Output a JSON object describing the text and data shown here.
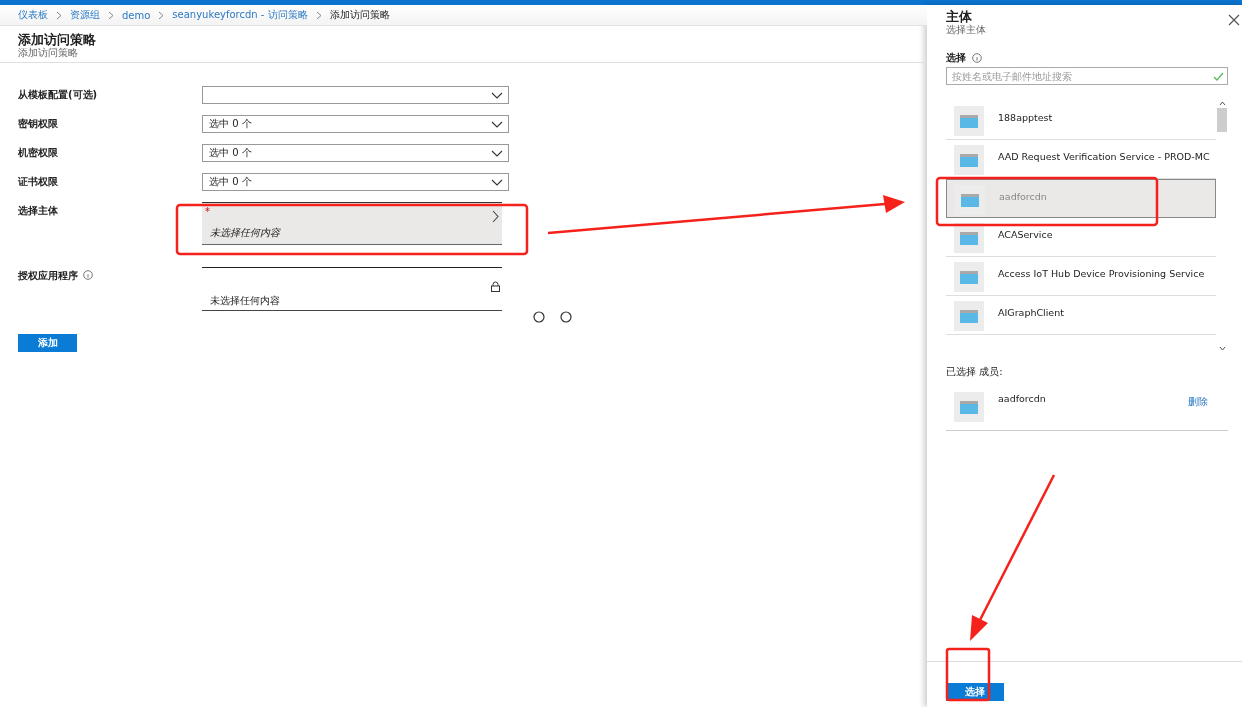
{
  "breadcrumb": [
    {
      "label": "仪表板",
      "current": false
    },
    {
      "label": "资源组",
      "current": false
    },
    {
      "label": "demo",
      "current": false
    },
    {
      "label": "seanyukeyforcdn - 访问策略",
      "current": false
    },
    {
      "label": "添加访问策略",
      "current": true
    }
  ],
  "page": {
    "title": "添加访问策略",
    "subtitle": "添加访问策略"
  },
  "form": [
    {
      "kind": "dropdown",
      "label": "从模板配置(可选)"
    },
    {
      "kind": "dropdown",
      "label": "密钥权限",
      "value": "选中 0 个"
    },
    {
      "kind": "dropdown",
      "label": "机密权限",
      "value": "选中 0 个"
    },
    {
      "kind": "dropdown",
      "label": "证书权限",
      "value": "选中 0 个"
    },
    {
      "kind": "picker",
      "label": "选择主体",
      "value": "未选择任何内容",
      "required_mark": "*"
    },
    {
      "kind": "locked",
      "label": "授权应用程序",
      "value": "未选择任何内容",
      "info": true
    }
  ],
  "add_button": "添加",
  "blade": {
    "title": "主体",
    "subtitle": "选择主体",
    "search_label": "选择",
    "search_placeholder": "按姓名或电子邮件地址搜索",
    "results": [
      {
        "name": "188apptest",
        "selected": false
      },
      {
        "name": "AAD Request Verification Service - PROD-MC",
        "selected": false
      },
      {
        "name": "aadforcdn",
        "selected": true
      },
      {
        "name": "ACAService",
        "selected": false
      },
      {
        "name": "Access IoT Hub Device Provisioning Service",
        "selected": false
      },
      {
        "name": "AIGraphClient",
        "selected": false
      }
    ],
    "selected_label": "已选择 成员:",
    "members": [
      {
        "name": "aadforcdn",
        "action": "删除"
      }
    ],
    "select_button": "选择"
  }
}
